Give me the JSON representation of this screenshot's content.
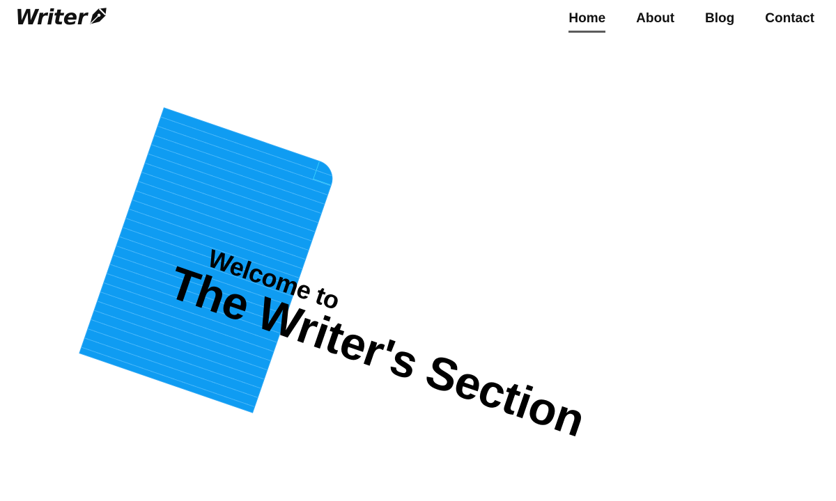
{
  "header": {
    "logo_text": "Writer",
    "logo_icon": "fountain-pen-icon",
    "nav": [
      {
        "label": "Home",
        "active": true
      },
      {
        "label": "About",
        "active": false
      },
      {
        "label": "Blog",
        "active": false
      },
      {
        "label": "Contact",
        "active": false
      }
    ]
  },
  "hero": {
    "line1": "Welcome to",
    "line2": "The Writer's Section",
    "notepad_color": "#0f9cf2"
  },
  "colors": {
    "text": "#111111",
    "active_underline": "#5b5b5b",
    "notepad_blue": "#0f9cf2",
    "fold_cyan": "#3cd6ff"
  }
}
